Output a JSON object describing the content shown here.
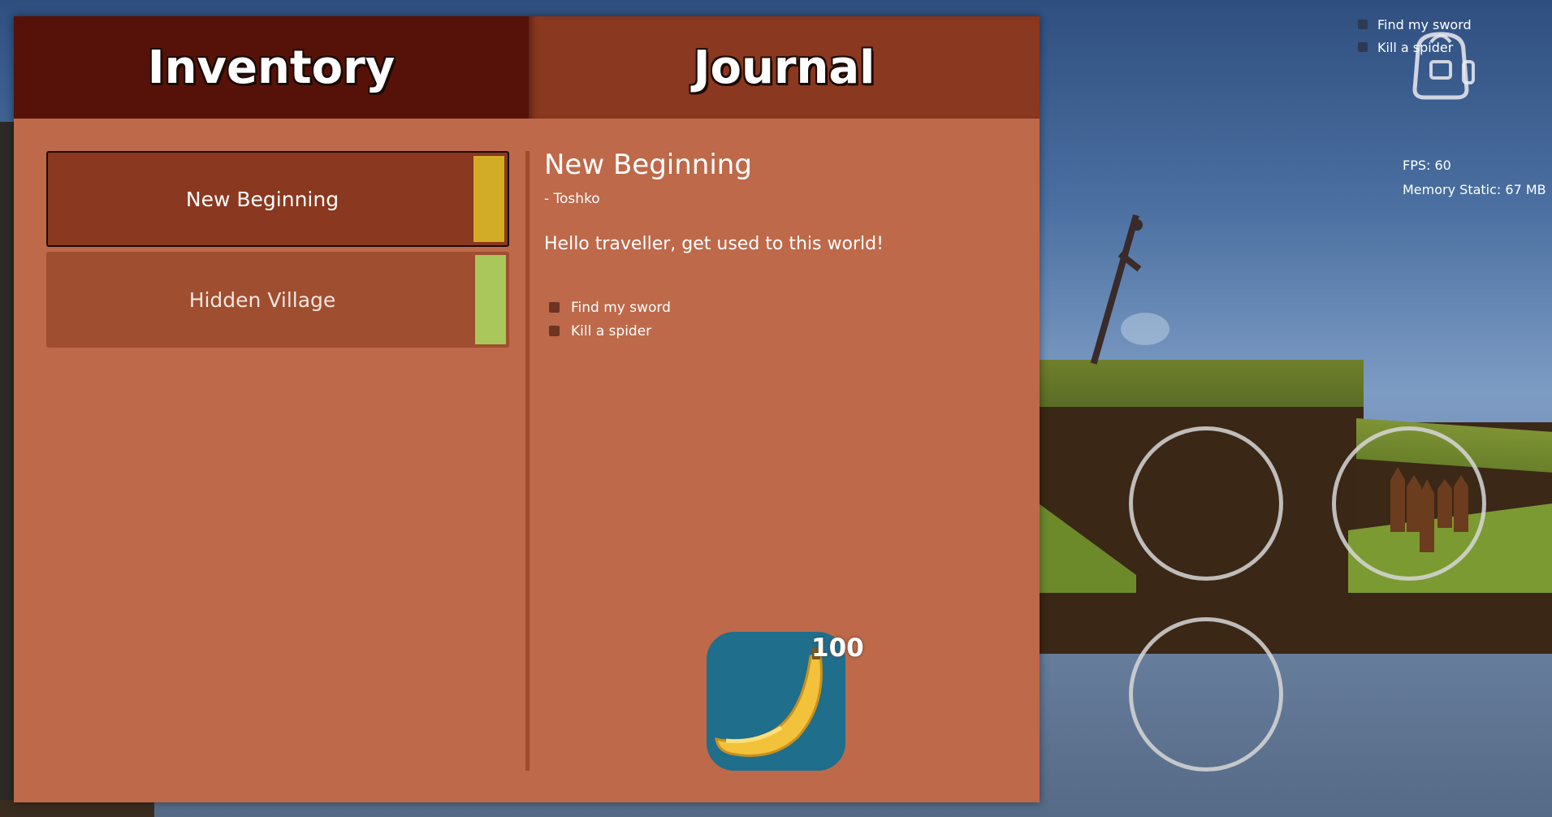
{
  "tabs": {
    "inventory": "Inventory",
    "journal": "Journal"
  },
  "quests": [
    {
      "name": "New Beginning",
      "color": "#d2ac25",
      "active": true
    },
    {
      "name": "Hidden Village",
      "color": "#a9c75a",
      "active": false
    }
  ],
  "journal": {
    "title": "New Beginning",
    "author": "- Toshko",
    "text": "Hello traveller, get used to this world!",
    "objectives": [
      "Find my sword",
      "Kill a spider"
    ]
  },
  "hud": {
    "objectives": [
      "Find my sword",
      "Kill a spider"
    ],
    "fps": "FPS: 60",
    "memory": "Memory Static: 67 MB"
  },
  "item": {
    "name": "banana-icon",
    "count": "100"
  }
}
